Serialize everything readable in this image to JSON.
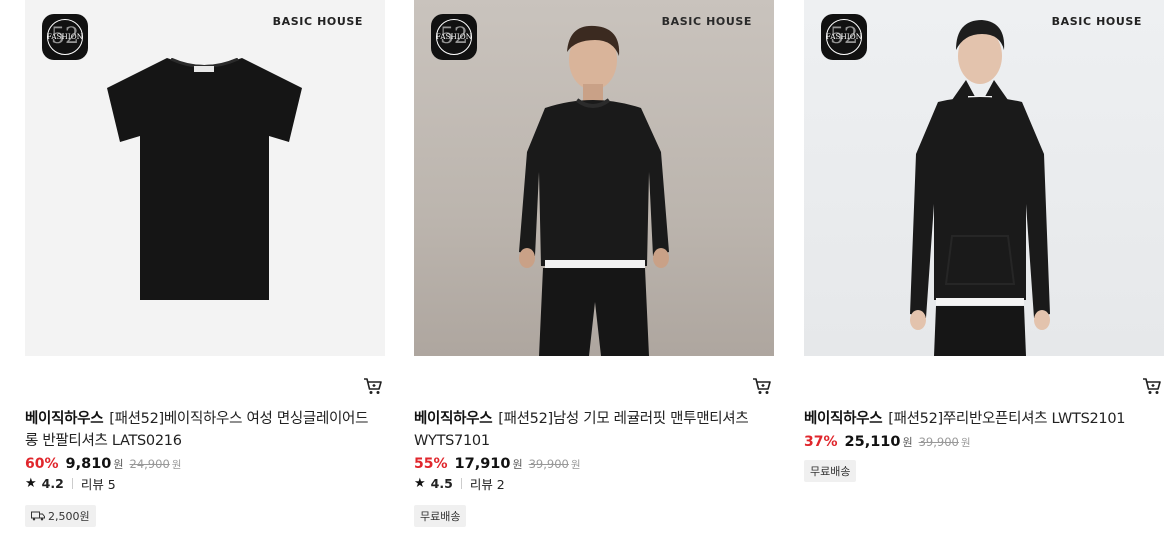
{
  "products": [
    {
      "badge": {
        "num": "52",
        "text": "FASHION"
      },
      "brand_mark": "BASIC HOUSE",
      "brand": "베이직하우스",
      "title": "[패션52]베이직하우스 여성 면싱글레이어드 롱 반팔티셔츠 LATS0216",
      "discount": "60%",
      "sale_price": "9,810",
      "currency": "원",
      "original_price": "24,900",
      "rating": "4.2",
      "reviews": "리뷰 5",
      "shipping": "2,500원",
      "shipping_icon": "truck-icon"
    },
    {
      "badge": {
        "num": "52",
        "text": "FASHION"
      },
      "brand_mark": "BASIC HOUSE",
      "brand": "베이직하우스",
      "title": "[패션52]남성 기모 레귤러핏 맨투맨티셔츠 WYTS7101",
      "discount": "55%",
      "sale_price": "17,910",
      "currency": "원",
      "original_price": "39,900",
      "rating": "4.5",
      "reviews": "리뷰 2",
      "shipping": "무료배송"
    },
    {
      "badge": {
        "num": "52",
        "text": "FASHION"
      },
      "brand_mark": "BASIC HOUSE",
      "brand": "베이직하우스",
      "title": "[패션52]쭈리반오픈티셔츠 LWTS2101",
      "discount": "37%",
      "sale_price": "25,110",
      "currency": "원",
      "original_price": "39,900",
      "shipping": "무료배송"
    }
  ],
  "colors": {
    "discount": "#e0262c",
    "tag_bg": "#f0f0f0",
    "badge_bg": "#111111"
  },
  "icons": {
    "cart": "cart-icon",
    "star": "star-icon"
  }
}
